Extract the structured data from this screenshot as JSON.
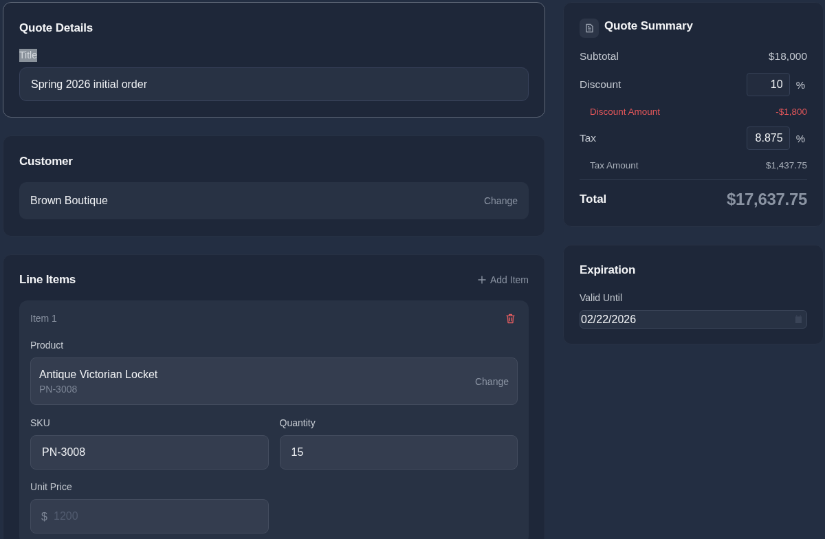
{
  "quote_details": {
    "title": "Quote Details",
    "focused": true,
    "field": {
      "label": "Title",
      "label_selected": true,
      "value": "Spring 2026 initial order"
    }
  },
  "customer": {
    "title": "Customer",
    "name": "Brown Boutique",
    "action": "Change"
  },
  "line_items": {
    "title": "Line Items",
    "add_action": "Add Item",
    "items": [
      {
        "label": "Item 1",
        "product": {
          "label": "Product",
          "name": "Antique Victorian Locket",
          "code": "PN-3008",
          "action": "Change"
        },
        "fields": [
          {
            "label": "SKU",
            "value": "PN-3008"
          },
          {
            "label": "Quantity",
            "value": "15"
          },
          {
            "label": "Unit Price",
            "prefix": "$",
            "placeholder": "1200"
          }
        ]
      }
    ]
  },
  "summary": {
    "title": "Quote Summary",
    "rows": [
      {
        "kind": "amount",
        "label": "Subtotal",
        "value": "$18,000"
      },
      {
        "kind": "percent",
        "label": "Discount",
        "value": "10",
        "unit": "%"
      },
      {
        "kind": "sub",
        "label": "Discount Amount",
        "value": "-$1,800",
        "negative": true
      },
      {
        "kind": "percent",
        "label": "Tax",
        "value": "8.875",
        "unit": "%"
      },
      {
        "kind": "sub",
        "label": "Tax Amount",
        "value": "$1,437.75",
        "negative": false
      }
    ],
    "total": {
      "label": "Total",
      "value": "$17,637.75"
    }
  },
  "expiration": {
    "title": "Expiration",
    "field": {
      "label": "Valid Until",
      "value": "02/22/2026"
    }
  }
}
